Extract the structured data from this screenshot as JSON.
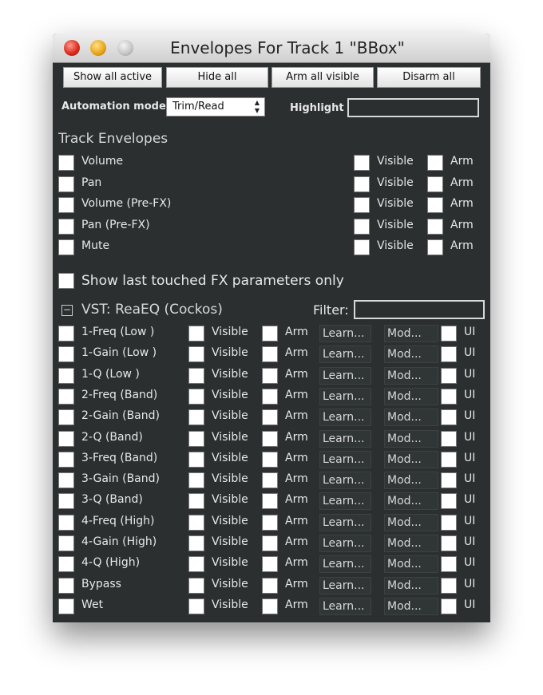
{
  "window": {
    "title": "Envelopes For Track 1 \"BBox\""
  },
  "toolbar": {
    "show_all_active": "Show all active",
    "hide_all": "Hide all",
    "arm_all_visible": "Arm all visible",
    "disarm_all": "Disarm all"
  },
  "automation": {
    "label": "Automation mode",
    "value": "Trim/Read",
    "highlight_label": "Highlight",
    "highlight_value": ""
  },
  "track_envelopes": {
    "heading": "Track Envelopes",
    "visible_label": "Visible",
    "arm_label": "Arm",
    "items": [
      "Volume",
      "Pan",
      "Volume (Pre-FX)",
      "Pan (Pre-FX)",
      "Mute"
    ]
  },
  "fx_toggle": {
    "label": "Show last touched FX parameters only",
    "checked": false
  },
  "fx": {
    "collapse_symbol": "−",
    "heading": "VST: ReaEQ (Cockos)",
    "filter_label": "Filter:",
    "filter_value": "",
    "visible_label": "Visible",
    "arm_label": "Arm",
    "learn_label": "Learn...",
    "mod_label": "Mod...",
    "ui_label": "UI",
    "params": [
      "1-Freq (Low )",
      "1-Gain (Low )",
      "1-Q (Low )",
      "2-Freq (Band)",
      "2-Gain (Band)",
      "2-Q (Band)",
      "3-Freq (Band)",
      "3-Gain (Band)",
      "3-Q (Band)",
      "4-Freq (High)",
      "4-Gain (High)",
      "4-Q (High)",
      "Bypass",
      "Wet"
    ]
  }
}
